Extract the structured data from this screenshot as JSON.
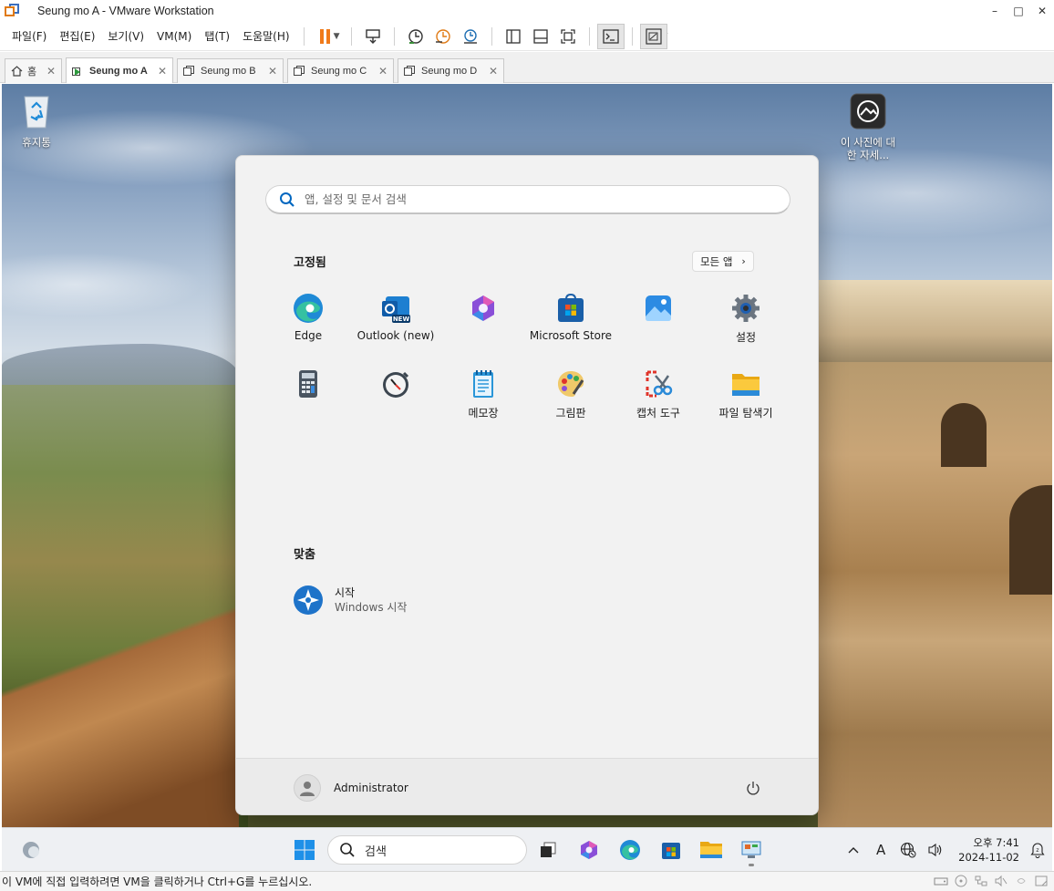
{
  "window": {
    "title": "Seung mo A - VMware Workstation",
    "controls": [
      "–",
      "□",
      "✕"
    ]
  },
  "menu": [
    "파일(F)",
    "편집(E)",
    "보기(V)",
    "VM(M)",
    "탭(T)",
    "도움말(H)"
  ],
  "tabs": [
    {
      "label": "홈",
      "icon": "home-icon",
      "active": false
    },
    {
      "label": "Seung mo A",
      "icon": "vm-running-icon",
      "active": true
    },
    {
      "label": "Seung mo B",
      "icon": "vm-icon",
      "active": false
    },
    {
      "label": "Seung mo C",
      "icon": "vm-icon",
      "active": false
    },
    {
      "label": "Seung mo D",
      "icon": "vm-icon",
      "active": false
    }
  ],
  "desktop": {
    "recycle_bin": "휴지통",
    "spotlight": "이 사진에 대한 자세..."
  },
  "start_menu": {
    "search_placeholder": "앱, 설정 및 문서 검색",
    "pinned_title": "고정됨",
    "all_apps": "모든 앱",
    "pinned": [
      {
        "label": "Edge",
        "icon": "edge-icon"
      },
      {
        "label": "Outlook (new)",
        "icon": "outlook-icon"
      },
      {
        "label": "",
        "icon": "copilot-icon"
      },
      {
        "label": "Microsoft Store",
        "icon": "store-icon"
      },
      {
        "label": "",
        "icon": "photos-icon"
      },
      {
        "label": "설정",
        "icon": "settings-icon"
      },
      {
        "label": "",
        "icon": "calculator-icon"
      },
      {
        "label": "",
        "icon": "clock-icon"
      },
      {
        "label": "메모장",
        "icon": "notepad-icon"
      },
      {
        "label": "그림판",
        "icon": "paint-icon"
      },
      {
        "label": "캡처 도구",
        "icon": "snipping-tool-icon"
      },
      {
        "label": "파일 탐색기",
        "icon": "file-explorer-icon"
      }
    ],
    "recommended_title": "맞춤",
    "recommended": {
      "title": "시작",
      "subtitle": "Windows 시작"
    },
    "user": "Administrator"
  },
  "taskbar": {
    "search_label": "검색",
    "time": "오후 7:41",
    "date": "2024-11-02",
    "ime": "A"
  },
  "statusbar": {
    "message": "이 VM에 직접 입력하려면 VM을 클릭하거나 Ctrl+G를 누르십시오."
  },
  "colors": {
    "accent": "#0067c0",
    "vmware_orange": "#e07a14"
  }
}
